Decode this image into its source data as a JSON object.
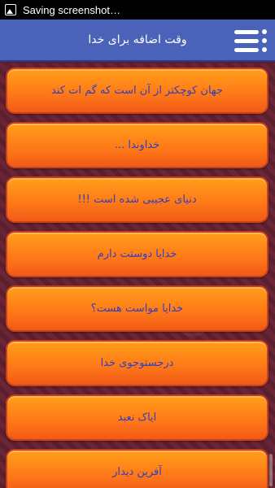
{
  "status_bar": {
    "notification_text": "Saving screenshot…",
    "icon": "image-icon"
  },
  "app_bar": {
    "title": "وقت اضافه برای خدا",
    "menu_icon": "menu-icon"
  },
  "colors": {
    "app_bar": "#4a62b8",
    "item_orange": "#ff7a18",
    "item_text": "#2f3fbf",
    "background": "#5a1e2c"
  },
  "items": [
    {
      "label": "جهان کوچکتر از آن است که گم ات کند"
    },
    {
      "label": "خداوندا ..."
    },
    {
      "label": "دنیای عجیبی شده است !!!"
    },
    {
      "label": "خدایا دوستت دارم"
    },
    {
      "label": "خدایا مواست هست؟"
    },
    {
      "label": "درجستوجوی خدا"
    },
    {
      "label": "ایاک نعبد"
    },
    {
      "label": "آفرین دیدار"
    }
  ]
}
